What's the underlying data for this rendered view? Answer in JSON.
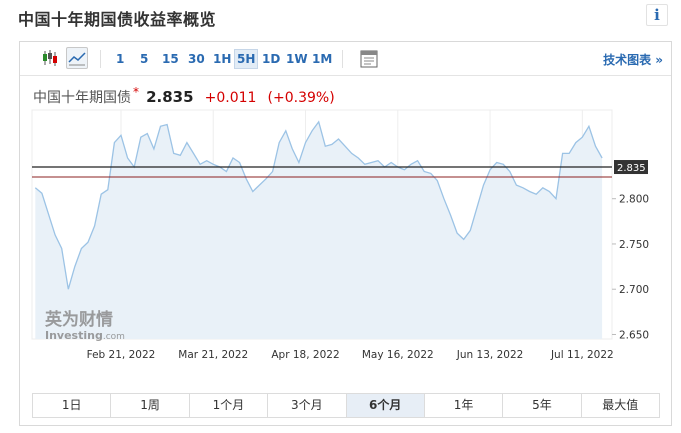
{
  "page": {
    "title": "中国十年期国债收益率概览",
    "info_label": "i"
  },
  "toolbar": {
    "icons": [
      "candlestick-icon",
      "line-chart-icon"
    ],
    "ranges": [
      {
        "label": "1",
        "active": false
      },
      {
        "label": "5",
        "active": false
      },
      {
        "label": "15",
        "active": false
      },
      {
        "label": "30",
        "active": false
      },
      {
        "label": "1H",
        "active": false
      },
      {
        "label": "5H",
        "active": true
      },
      {
        "label": "1D",
        "active": false
      },
      {
        "label": "1W",
        "active": false
      },
      {
        "label": "1M",
        "active": false
      }
    ],
    "doc_icon": "document-icon",
    "tech_link": "技术图表 »"
  },
  "quote": {
    "name": "中国十年期国债",
    "star": "*",
    "price": "2.835",
    "change": "+0.011",
    "change_pct": "(+0.39%)"
  },
  "watermark": {
    "cn": "英为财情",
    "en": "Investing",
    "suffix": ".com"
  },
  "colors": {
    "accent": "#2a6ab1",
    "positive": "#d40000",
    "line": "#9cc3e5",
    "fill": "#e9f1f8"
  },
  "chart_data": {
    "type": "area",
    "x": [
      "2022-01-26",
      "2022-01-28",
      "2022-02-01",
      "2022-02-03",
      "2022-02-05",
      "2022-02-07",
      "2022-02-09",
      "2022-02-11",
      "2022-02-13",
      "2022-02-15",
      "2022-02-17",
      "2022-02-19",
      "2022-02-21",
      "2022-02-23",
      "2022-02-25",
      "2022-02-27",
      "2022-03-01",
      "2022-03-03",
      "2022-03-05",
      "2022-03-07",
      "2022-03-09",
      "2022-03-11",
      "2022-03-13",
      "2022-03-15",
      "2022-03-17",
      "2022-03-19",
      "2022-03-21",
      "2022-03-23",
      "2022-03-25",
      "2022-03-27",
      "2022-03-29",
      "2022-03-31",
      "2022-04-02",
      "2022-04-04",
      "2022-04-06",
      "2022-04-08",
      "2022-04-10",
      "2022-04-12",
      "2022-04-14",
      "2022-04-16",
      "2022-04-18",
      "2022-04-20",
      "2022-04-22",
      "2022-04-24",
      "2022-04-26",
      "2022-04-28",
      "2022-04-30",
      "2022-05-02",
      "2022-05-04",
      "2022-05-06",
      "2022-05-08",
      "2022-05-10",
      "2022-05-12",
      "2022-05-14",
      "2022-05-16",
      "2022-05-18",
      "2022-05-20",
      "2022-05-22",
      "2022-05-24",
      "2022-05-26",
      "2022-05-28",
      "2022-05-30",
      "2022-06-01",
      "2022-06-03",
      "2022-06-05",
      "2022-06-07",
      "2022-06-09",
      "2022-06-11",
      "2022-06-13",
      "2022-06-15",
      "2022-06-17",
      "2022-06-19",
      "2022-06-21",
      "2022-06-23",
      "2022-06-25",
      "2022-06-27",
      "2022-06-29",
      "2022-07-01",
      "2022-07-03",
      "2022-07-05",
      "2022-07-07",
      "2022-07-09",
      "2022-07-11",
      "2022-07-13",
      "2022-07-15",
      "2022-07-17"
    ],
    "values": [
      2.812,
      2.806,
      2.76,
      2.745,
      2.7,
      2.725,
      2.745,
      2.752,
      2.77,
      2.805,
      2.81,
      2.862,
      2.87,
      2.845,
      2.835,
      2.868,
      2.872,
      2.855,
      2.88,
      2.882,
      2.85,
      2.848,
      2.862,
      2.85,
      2.838,
      2.842,
      2.838,
      2.835,
      2.83,
      2.845,
      2.84,
      2.822,
      2.808,
      2.815,
      2.822,
      2.83,
      2.862,
      2.875,
      2.855,
      2.84,
      2.862,
      2.875,
      2.885,
      2.858,
      2.86,
      2.866,
      2.858,
      2.85,
      2.845,
      2.838,
      2.84,
      2.842,
      2.835,
      2.84,
      2.835,
      2.832,
      2.838,
      2.842,
      2.83,
      2.828,
      2.82,
      2.8,
      2.782,
      2.762,
      2.755,
      2.765,
      2.79,
      2.815,
      2.832,
      2.84,
      2.838,
      2.83,
      2.815,
      2.812,
      2.808,
      2.805,
      2.812,
      2.808,
      2.8,
      2.85,
      2.85,
      2.862,
      2.868,
      2.88,
      2.858,
      2.845
    ],
    "x_tick_labels": [
      {
        "x": "2022-02-21",
        "label": "Feb 21, 2022"
      },
      {
        "x": "2022-03-21",
        "label": "Mar 21, 2022"
      },
      {
        "x": "2022-04-18",
        "label": "Apr 18, 2022"
      },
      {
        "x": "2022-05-16",
        "label": "May 16, 2022"
      },
      {
        "x": "2022-06-13",
        "label": "Jun 13, 2022"
      },
      {
        "x": "2022-07-11",
        "label": "Jul 11, 2022"
      }
    ],
    "y_ticks": [
      2.65,
      2.7,
      2.75,
      2.8
    ],
    "y_tick_labels": [
      "2.650",
      "2.700",
      "2.750",
      "2.800"
    ],
    "ylim": [
      2.645,
      2.898
    ],
    "xlim": [
      "2022-01-25",
      "2022-07-20"
    ],
    "current_value": 2.835,
    "current_label": "2.835",
    "reference_value": 2.824,
    "grid": "vertical"
  },
  "periods": [
    {
      "label": "1日",
      "active": false
    },
    {
      "label": "1周",
      "active": false
    },
    {
      "label": "1个月",
      "active": false
    },
    {
      "label": "3个月",
      "active": false
    },
    {
      "label": "6个月",
      "active": true
    },
    {
      "label": "1年",
      "active": false
    },
    {
      "label": "5年",
      "active": false
    },
    {
      "label": "最大值",
      "active": false
    }
  ]
}
